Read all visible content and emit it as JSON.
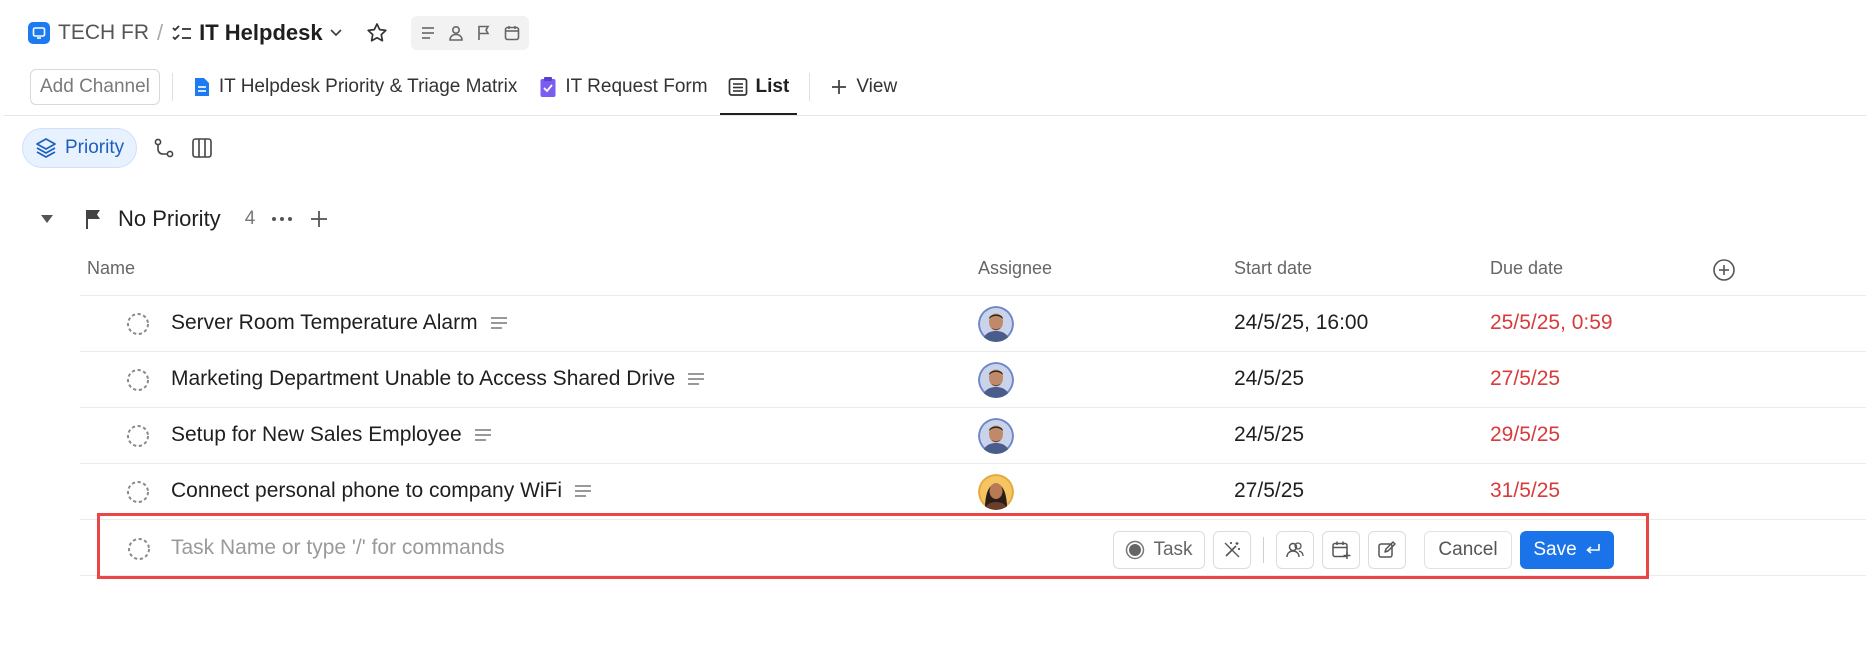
{
  "breadcrumb": {
    "workspace": "TECH FR",
    "separator": "/",
    "list_title": "IT Helpdesk"
  },
  "tabs": {
    "add_channel": "Add Channel",
    "items": [
      {
        "label": "IT Helpdesk Priority & Triage Matrix",
        "icon": "doc-icon",
        "color": "#1d7bf2"
      },
      {
        "label": "IT Request Form",
        "icon": "form-icon",
        "color": "#7b5cf0"
      },
      {
        "label": "List",
        "icon": "list-view-icon",
        "active": true
      }
    ],
    "add_view": "View"
  },
  "toolbar": {
    "group_by_label": "Priority"
  },
  "group": {
    "title": "No Priority",
    "count": "4"
  },
  "columns": {
    "name": "Name",
    "assignee": "Assignee",
    "start": "Start date",
    "due": "Due date"
  },
  "tasks": [
    {
      "name": "Server Room Temperature Alarm",
      "start": "24/5/25, 16:00",
      "due": "25/5/25, 0:59",
      "avatar": "man"
    },
    {
      "name": "Marketing Department Unable to Access Shared Drive",
      "start": "24/5/25",
      "due": "27/5/25",
      "avatar": "man"
    },
    {
      "name": "Setup for New Sales Employee",
      "start": "24/5/25",
      "due": "29/5/25",
      "avatar": "man"
    },
    {
      "name": "Connect personal phone to company WiFi",
      "start": "27/5/25",
      "due": "31/5/25",
      "avatar": "woman"
    }
  ],
  "new_task": {
    "placeholder": "Task Name or type '/' for commands",
    "type_label": "Task",
    "cancel": "Cancel",
    "save": "Save"
  },
  "colors": {
    "accent": "#1a73e8",
    "overdue": "#d83b3b",
    "highlight_border": "#ec4545"
  }
}
